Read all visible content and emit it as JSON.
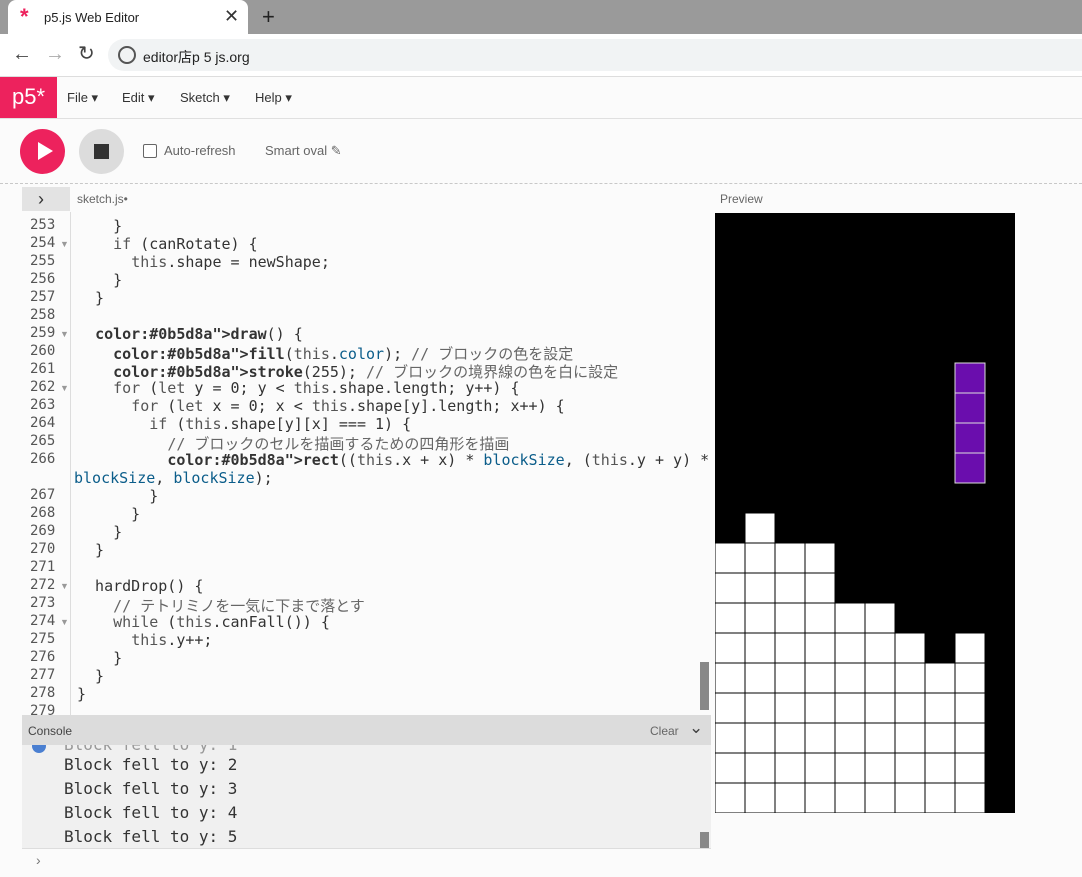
{
  "browser": {
    "tab_title": "p5.js Web Editor",
    "tab_close": "✕",
    "new_tab": "+",
    "url": "editor店p 5 js.org"
  },
  "header": {
    "logo": "p5*",
    "menus": [
      "File ▾",
      "Edit ▾",
      "Sketch ▾",
      "Help ▾"
    ]
  },
  "toolbar": {
    "auto_refresh_label": "Auto-refresh",
    "auto_refresh_checked": false,
    "sketch_name": "Smart oval ✎"
  },
  "editor": {
    "file_tab": "sketch.js•",
    "expand_icon": "›",
    "preview_label": "Preview",
    "lines": [
      {
        "n": "253",
        "code": "    }"
      },
      {
        "n": "254",
        "code": "    if (canRotate) {",
        "fold": true
      },
      {
        "n": "255",
        "code": "      this.shape = newShape;"
      },
      {
        "n": "256",
        "code": "    }"
      },
      {
        "n": "257",
        "code": "  }"
      },
      {
        "n": "258",
        "code": ""
      },
      {
        "n": "259",
        "code": "  draw() {",
        "fold": true
      },
      {
        "n": "260",
        "code": "    fill(this.color); // ブロックの色を設定"
      },
      {
        "n": "261",
        "code": "    stroke(255); // ブロックの境界線の色を白に設定"
      },
      {
        "n": "262",
        "code": "    for (let y = 0; y < this.shape.length; y++) {",
        "fold": true
      },
      {
        "n": "263",
        "code": "      for (let x = 0; x < this.shape[y].length; x++) {"
      },
      {
        "n": "264",
        "code": "        if (this.shape[y][x] === 1) {"
      },
      {
        "n": "265",
        "code": "          // ブロックのセルを描画するための四角形を描画"
      },
      {
        "n": "266",
        "code": "          rect((this.x + x) * blockSize, (this.y + y) * blockSize,"
      },
      {
        "n": "",
        "code": "blockSize, blockSize);",
        "wrap": true
      },
      {
        "n": "267",
        "code": "        }"
      },
      {
        "n": "268",
        "code": "      }"
      },
      {
        "n": "269",
        "code": "    }"
      },
      {
        "n": "270",
        "code": "  }"
      },
      {
        "n": "271",
        "code": ""
      },
      {
        "n": "272",
        "code": "  hardDrop() {",
        "fold": true
      },
      {
        "n": "273",
        "code": "    // テトリミノを一気に下まで落とす"
      },
      {
        "n": "274",
        "code": "    while (this.canFall()) {",
        "fold": true
      },
      {
        "n": "275",
        "code": "      this.y++;"
      },
      {
        "n": "276",
        "code": "    }"
      },
      {
        "n": "277",
        "code": "  }"
      },
      {
        "n": "278",
        "code": "}"
      },
      {
        "n": "279",
        "code": ""
      }
    ]
  },
  "console": {
    "title": "Console",
    "clear_label": "Clear",
    "chevron": "⌄",
    "lines": [
      "Block fell to y: 2",
      "Block fell to y: 3",
      "Block fell to y: 4",
      "Block fell to y: 5"
    ],
    "prompt": "›"
  },
  "colors": {
    "accent": "#ed225d",
    "piece": "#6a0dad",
    "board_bg": "#000000",
    "locked_block": "#ffffff"
  },
  "game": {
    "cols": 10,
    "rows": 20,
    "active_piece": [
      [
        8,
        5
      ],
      [
        8,
        6
      ],
      [
        8,
        7
      ],
      [
        8,
        8
      ]
    ],
    "column_heights": [
      9,
      10,
      9,
      9,
      7,
      7,
      6,
      5,
      6,
      0
    ]
  }
}
